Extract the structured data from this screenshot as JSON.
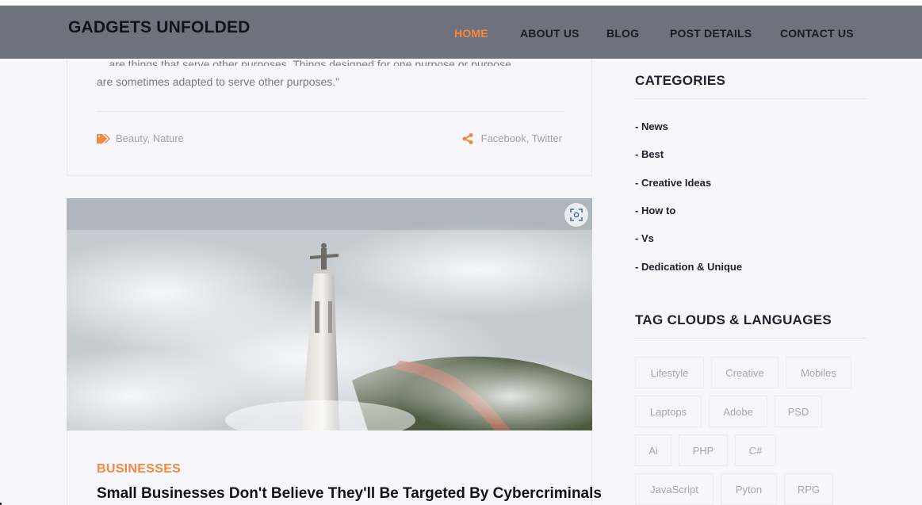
{
  "header": {
    "logo": "GADGETS UNFOLDED",
    "nav": [
      {
        "label": "HOME",
        "active": true
      },
      {
        "label": "ABOUT US",
        "active": false
      },
      {
        "label": "BLOG",
        "active": false
      },
      {
        "label": "POST DETAILS",
        "active": false
      },
      {
        "label": "CONTACT US",
        "active": false
      }
    ]
  },
  "post_prev": {
    "quote_line_1": "... are things that serve other purposes. Things designed for one purpose or purpose",
    "quote_line_2": "are sometimes adapted to serve other purposes.\"",
    "tags": "Beauty, Nature",
    "share": "Facebook, Twitter"
  },
  "post_next": {
    "category": "BUSINESSES",
    "title": "Small Businesses Don't Believe They'll Be Targeted By Cybercriminals"
  },
  "sidebar": {
    "categories_title": "CATEGORIES",
    "categories": [
      "- News",
      "- Best",
      "- Creative Ideas",
      "- How to",
      "- Vs",
      "- Dedication & Unique"
    ],
    "tags_title": "TAG CLOUDS & LANGUAGES",
    "tags": [
      "Lifestyle",
      "Creative",
      "Mobiles",
      "Laptops",
      "Adobe",
      "PSD",
      "Ai",
      "PHP",
      "C#",
      "JavaScript",
      "Pyton",
      "RPG"
    ]
  },
  "colors": {
    "accent": "#f48840",
    "header_bg": "#6d727c",
    "page_bg": "#f7f7fb"
  },
  "icons": {
    "tags": "tags-icon",
    "share": "share-icon",
    "zoom": "zoom-lens-icon"
  }
}
